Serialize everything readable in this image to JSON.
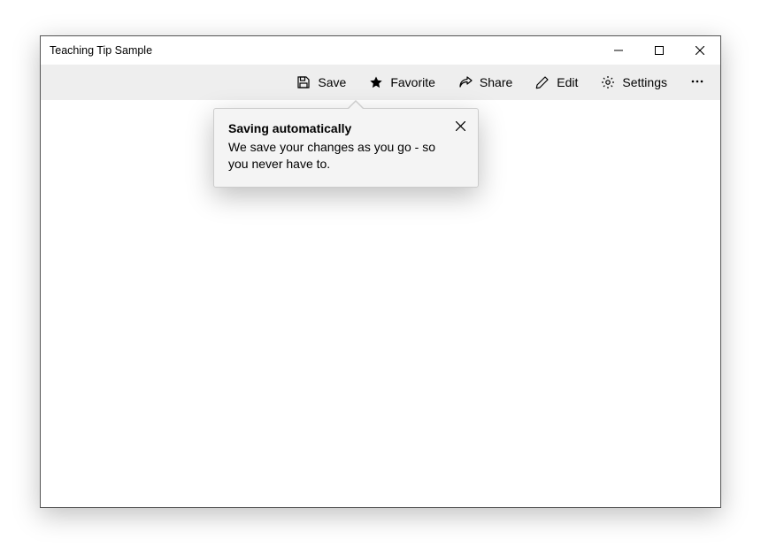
{
  "window": {
    "title": "Teaching Tip Sample"
  },
  "commandbar": {
    "save": {
      "label": "Save"
    },
    "favorite": {
      "label": "Favorite"
    },
    "share": {
      "label": "Share"
    },
    "edit": {
      "label": "Edit"
    },
    "settings": {
      "label": "Settings"
    }
  },
  "teaching_tip": {
    "title": "Saving automatically",
    "subtitle": "We save your changes as you go - so you never have to."
  }
}
